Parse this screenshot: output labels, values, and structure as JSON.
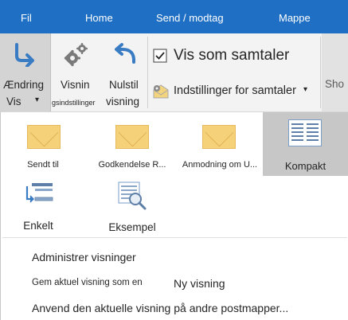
{
  "tabs": {
    "fil": "Fil",
    "home": "Home",
    "send": "Send / modtag",
    "mappe": "Mappe"
  },
  "ribbon": {
    "change_view": {
      "line1": "Ændring",
      "line2": "Vis",
      "arrow": "▾"
    },
    "view_settings": {
      "line1": "Visnin",
      "line2": "gsindstillinger"
    },
    "reset_view": {
      "line1": "Nulstil",
      "line2": "visning"
    },
    "show_as_conversations": {
      "label": "Vis som samtaler",
      "checked": true
    },
    "conversation_settings": {
      "label": "Indstillinger for samtaler",
      "arrow": "▾"
    },
    "cut_off_group": "Sho"
  },
  "views": [
    {
      "label": "Sendt til",
      "icon": "envelope-icon"
    },
    {
      "label": "Godkendelse R...",
      "icon": "envelope-icon"
    },
    {
      "label": "Anmodning om U...",
      "icon": "envelope-icon"
    },
    {
      "label": "Kompakt",
      "icon": "compact-list-icon",
      "selected": true
    },
    {
      "label": "Enkelt",
      "icon": "single-list-icon"
    },
    {
      "label": "Eksempel",
      "icon": "preview-icon"
    }
  ],
  "menu": {
    "manage_views": "Administrer visninger",
    "save_view_label": "Gem aktuel visning som en",
    "save_view_value": "Ny visning",
    "apply_view": "Anvend den aktuelle visning på andre postmapper..."
  },
  "colors": {
    "tabbar": "#1f6fc4",
    "selected_view": "#c7c7c7",
    "change_view_bg": "#d4d4d4",
    "envelope": "#f5d17a"
  }
}
